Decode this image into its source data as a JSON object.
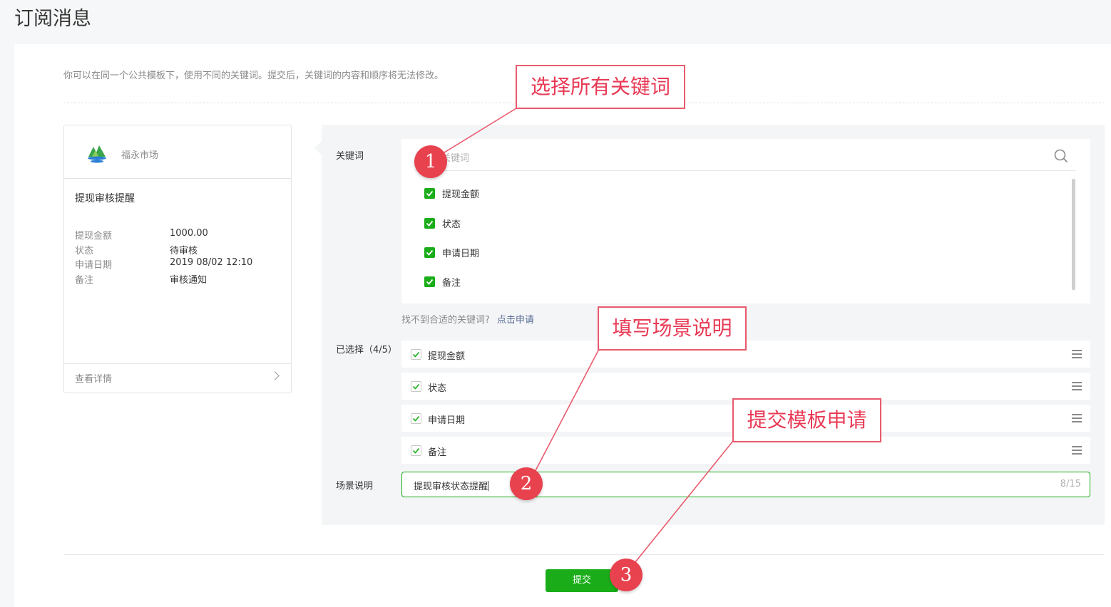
{
  "page": {
    "title": "订阅消息"
  },
  "intro": "你可以在同一个公共模板下，使用不同的关键词。提交后，关键词的内容和顺序将无法修改。",
  "preview": {
    "app_name": "福永市场",
    "message_title": "提现审核提醒",
    "fields": [
      {
        "key": "提现金额",
        "value": "1000.00"
      },
      {
        "key": "状态",
        "value": "待审核"
      },
      {
        "key": "申请日期",
        "value": "2019 08/02 12:10"
      },
      {
        "key": "备注",
        "value": "审核通知"
      }
    ],
    "detail_link": "查看详情"
  },
  "keywords": {
    "label": "关键词",
    "search_placeholder": "关键词",
    "items": [
      {
        "label": "提现金额",
        "checked": true
      },
      {
        "label": "状态",
        "checked": true
      },
      {
        "label": "申请日期",
        "checked": true
      },
      {
        "label": "备注",
        "checked": true
      }
    ],
    "hint": "找不到合适的关键词?",
    "hint_link": "点击申请"
  },
  "selected": {
    "label": "已选择（4/5）",
    "items": [
      {
        "label": "提现金额"
      },
      {
        "label": "状态"
      },
      {
        "label": "申请日期"
      },
      {
        "label": "备注"
      }
    ]
  },
  "scene": {
    "label": "场景说明",
    "value": "提现审核状态提醒",
    "counter": "8/15"
  },
  "submit_label": "提交",
  "annotations": {
    "callout_1": "选择所有关键词",
    "callout_2": "填写场景说明",
    "callout_3": "提交模板申请",
    "badge_1": "1",
    "badge_2": "2",
    "badge_3": "3"
  },
  "colors": {
    "accent": "#1aad19",
    "annotation": "#e8424f",
    "link": "#576b95"
  }
}
